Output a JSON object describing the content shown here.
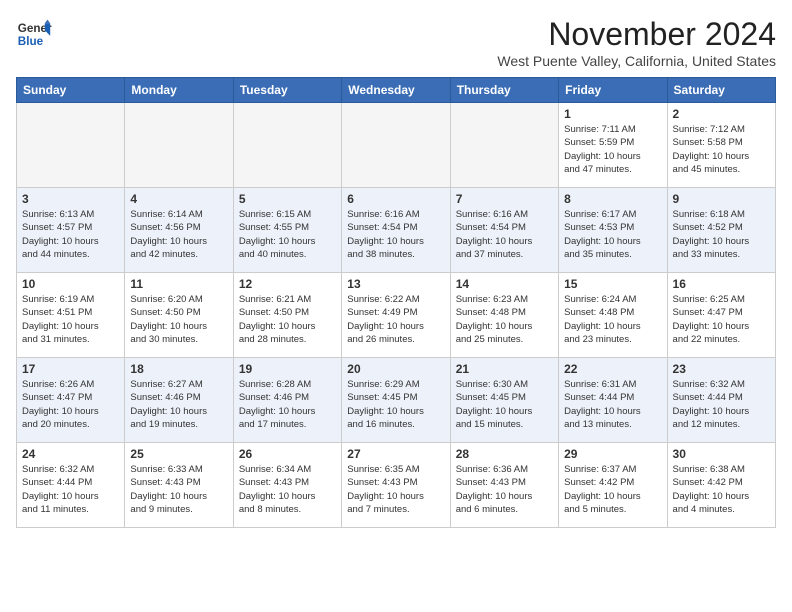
{
  "header": {
    "logo_line1": "General",
    "logo_line2": "Blue",
    "month": "November 2024",
    "location": "West Puente Valley, California, United States"
  },
  "weekdays": [
    "Sunday",
    "Monday",
    "Tuesday",
    "Wednesday",
    "Thursday",
    "Friday",
    "Saturday"
  ],
  "weeks": [
    {
      "alt": false,
      "days": [
        {
          "num": "",
          "info": "",
          "empty": true
        },
        {
          "num": "",
          "info": "",
          "empty": true
        },
        {
          "num": "",
          "info": "",
          "empty": true
        },
        {
          "num": "",
          "info": "",
          "empty": true
        },
        {
          "num": "",
          "info": "",
          "empty": true
        },
        {
          "num": "1",
          "info": "Sunrise: 7:11 AM\nSunset: 5:59 PM\nDaylight: 10 hours\nand 47 minutes.",
          "empty": false
        },
        {
          "num": "2",
          "info": "Sunrise: 7:12 AM\nSunset: 5:58 PM\nDaylight: 10 hours\nand 45 minutes.",
          "empty": false
        }
      ]
    },
    {
      "alt": true,
      "days": [
        {
          "num": "3",
          "info": "Sunrise: 6:13 AM\nSunset: 4:57 PM\nDaylight: 10 hours\nand 44 minutes.",
          "empty": false
        },
        {
          "num": "4",
          "info": "Sunrise: 6:14 AM\nSunset: 4:56 PM\nDaylight: 10 hours\nand 42 minutes.",
          "empty": false
        },
        {
          "num": "5",
          "info": "Sunrise: 6:15 AM\nSunset: 4:55 PM\nDaylight: 10 hours\nand 40 minutes.",
          "empty": false
        },
        {
          "num": "6",
          "info": "Sunrise: 6:16 AM\nSunset: 4:54 PM\nDaylight: 10 hours\nand 38 minutes.",
          "empty": false
        },
        {
          "num": "7",
          "info": "Sunrise: 6:16 AM\nSunset: 4:54 PM\nDaylight: 10 hours\nand 37 minutes.",
          "empty": false
        },
        {
          "num": "8",
          "info": "Sunrise: 6:17 AM\nSunset: 4:53 PM\nDaylight: 10 hours\nand 35 minutes.",
          "empty": false
        },
        {
          "num": "9",
          "info": "Sunrise: 6:18 AM\nSunset: 4:52 PM\nDaylight: 10 hours\nand 33 minutes.",
          "empty": false
        }
      ]
    },
    {
      "alt": false,
      "days": [
        {
          "num": "10",
          "info": "Sunrise: 6:19 AM\nSunset: 4:51 PM\nDaylight: 10 hours\nand 31 minutes.",
          "empty": false
        },
        {
          "num": "11",
          "info": "Sunrise: 6:20 AM\nSunset: 4:50 PM\nDaylight: 10 hours\nand 30 minutes.",
          "empty": false
        },
        {
          "num": "12",
          "info": "Sunrise: 6:21 AM\nSunset: 4:50 PM\nDaylight: 10 hours\nand 28 minutes.",
          "empty": false
        },
        {
          "num": "13",
          "info": "Sunrise: 6:22 AM\nSunset: 4:49 PM\nDaylight: 10 hours\nand 26 minutes.",
          "empty": false
        },
        {
          "num": "14",
          "info": "Sunrise: 6:23 AM\nSunset: 4:48 PM\nDaylight: 10 hours\nand 25 minutes.",
          "empty": false
        },
        {
          "num": "15",
          "info": "Sunrise: 6:24 AM\nSunset: 4:48 PM\nDaylight: 10 hours\nand 23 minutes.",
          "empty": false
        },
        {
          "num": "16",
          "info": "Sunrise: 6:25 AM\nSunset: 4:47 PM\nDaylight: 10 hours\nand 22 minutes.",
          "empty": false
        }
      ]
    },
    {
      "alt": true,
      "days": [
        {
          "num": "17",
          "info": "Sunrise: 6:26 AM\nSunset: 4:47 PM\nDaylight: 10 hours\nand 20 minutes.",
          "empty": false
        },
        {
          "num": "18",
          "info": "Sunrise: 6:27 AM\nSunset: 4:46 PM\nDaylight: 10 hours\nand 19 minutes.",
          "empty": false
        },
        {
          "num": "19",
          "info": "Sunrise: 6:28 AM\nSunset: 4:46 PM\nDaylight: 10 hours\nand 17 minutes.",
          "empty": false
        },
        {
          "num": "20",
          "info": "Sunrise: 6:29 AM\nSunset: 4:45 PM\nDaylight: 10 hours\nand 16 minutes.",
          "empty": false
        },
        {
          "num": "21",
          "info": "Sunrise: 6:30 AM\nSunset: 4:45 PM\nDaylight: 10 hours\nand 15 minutes.",
          "empty": false
        },
        {
          "num": "22",
          "info": "Sunrise: 6:31 AM\nSunset: 4:44 PM\nDaylight: 10 hours\nand 13 minutes.",
          "empty": false
        },
        {
          "num": "23",
          "info": "Sunrise: 6:32 AM\nSunset: 4:44 PM\nDaylight: 10 hours\nand 12 minutes.",
          "empty": false
        }
      ]
    },
    {
      "alt": false,
      "days": [
        {
          "num": "24",
          "info": "Sunrise: 6:32 AM\nSunset: 4:44 PM\nDaylight: 10 hours\nand 11 minutes.",
          "empty": false
        },
        {
          "num": "25",
          "info": "Sunrise: 6:33 AM\nSunset: 4:43 PM\nDaylight: 10 hours\nand 9 minutes.",
          "empty": false
        },
        {
          "num": "26",
          "info": "Sunrise: 6:34 AM\nSunset: 4:43 PM\nDaylight: 10 hours\nand 8 minutes.",
          "empty": false
        },
        {
          "num": "27",
          "info": "Sunrise: 6:35 AM\nSunset: 4:43 PM\nDaylight: 10 hours\nand 7 minutes.",
          "empty": false
        },
        {
          "num": "28",
          "info": "Sunrise: 6:36 AM\nSunset: 4:43 PM\nDaylight: 10 hours\nand 6 minutes.",
          "empty": false
        },
        {
          "num": "29",
          "info": "Sunrise: 6:37 AM\nSunset: 4:42 PM\nDaylight: 10 hours\nand 5 minutes.",
          "empty": false
        },
        {
          "num": "30",
          "info": "Sunrise: 6:38 AM\nSunset: 4:42 PM\nDaylight: 10 hours\nand 4 minutes.",
          "empty": false
        }
      ]
    }
  ]
}
